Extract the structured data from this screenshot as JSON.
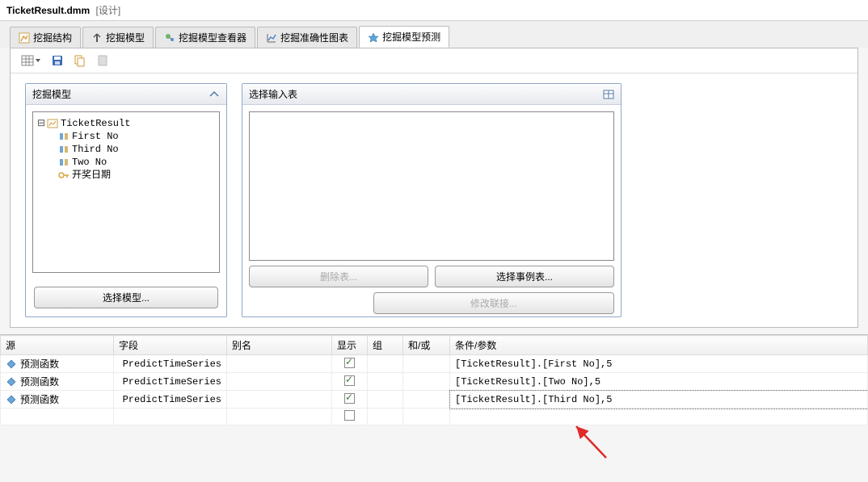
{
  "window": {
    "title": "TicketResult.dmm",
    "mode": "[设计]"
  },
  "tabs": [
    {
      "label": "挖掘结构"
    },
    {
      "label": "挖掘模型"
    },
    {
      "label": "挖掘模型查看器"
    },
    {
      "label": "挖掘准确性图表"
    },
    {
      "label": "挖掘模型预测"
    }
  ],
  "left_panel": {
    "title": "挖掘模型",
    "tree_root": "TicketResult",
    "tree_children": [
      "First No",
      "Third No",
      "Two No",
      "开奖日期"
    ],
    "select_button": "选择模型..."
  },
  "right_panel": {
    "title": "选择输入表",
    "delete_button": "删除表...",
    "select_case_button": "选择事例表...",
    "modify_button": "修改联接..."
  },
  "grid": {
    "headers": {
      "source": "源",
      "field": "字段",
      "alias": "别名",
      "show": "显示",
      "group": "组",
      "andor": "和/或",
      "criteria": "条件/参数"
    },
    "rows": [
      {
        "source": "预测函数",
        "field": "PredictTimeSeries",
        "show": true,
        "criteria": "[TicketResult].[First No],5"
      },
      {
        "source": "预测函数",
        "field": "PredictTimeSeries",
        "show": true,
        "criteria": "[TicketResult].[Two No],5"
      },
      {
        "source": "预测函数",
        "field": "PredictTimeSeries",
        "show": true,
        "criteria": "[TicketResult].[Third No],5"
      }
    ]
  }
}
